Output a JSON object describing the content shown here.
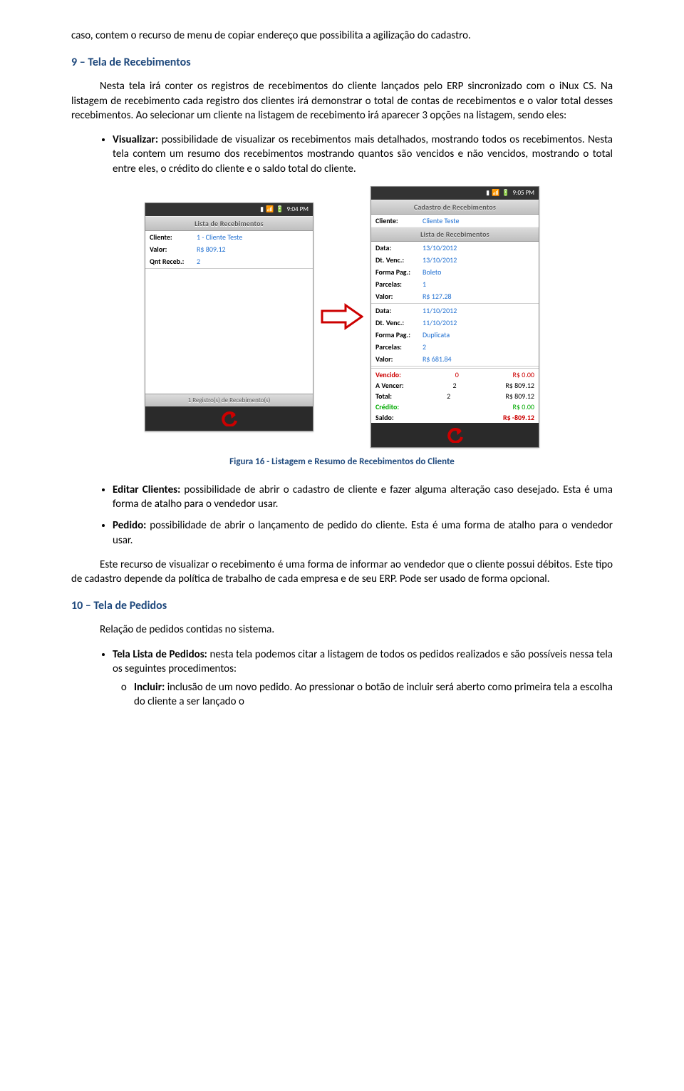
{
  "intro_para": "caso, contem o recurso de menu de copiar endereço que possibilita a agilização do cadastro.",
  "section9": {
    "heading": "9 – Tela de Recebimentos",
    "para": "Nesta tela irá conter os registros de recebimentos do cliente lançados pelo ERP sincronizado com o iNux CS. Na listagem de recebimento cada registro dos clientes irá demonstrar o total de contas de recebimentos e o valor total desses recebimentos. Ao selecionar um cliente na listagem de recebimento irá aparecer 3 opções na listagem, sendo eles:",
    "bullets": {
      "visualizar_label": "Visualizar:",
      "visualizar_text": " possibilidade de visualizar os recebimentos mais detalhados, mostrando todos os recebimentos. Nesta tela contem um resumo dos recebimentos mostrando quantos são vencidos e não vencidos, mostrando o total entre eles, o crédito do cliente e o saldo total do cliente.",
      "editar_label": "Editar Clientes:",
      "editar_text": " possibilidade de abrir o cadastro de cliente e fazer alguma alteração caso desejado. Esta é uma forma de atalho para o vendedor usar.",
      "pedido_label": "Pedido:",
      "pedido_text": " possibilidade de abrir o lançamento de pedido do cliente. Esta é uma forma de atalho para o vendedor usar."
    },
    "caption": "Figura 16 - Listagem e Resumo de Recebimentos do Cliente",
    "closing": "Este recurso de visualizar o recebimento é uma forma de informar ao vendedor que o cliente possui débitos. Este tipo de cadastro depende da política de trabalho de cada empresa e de seu ERP. Pode ser usado de forma opcional."
  },
  "section10": {
    "heading": "10 – Tela de Pedidos",
    "para": "Relação de pedidos contidas no sistema.",
    "bullets": {
      "lista_label": "Tela Lista de Pedidos:",
      "lista_text": " nesta tela podemos citar a listagem de todos os pedidos realizados e são possíveis nessa tela os seguintes procedimentos:",
      "incluir_label": "Incluir:",
      "incluir_text": " inclusão de um novo pedido. Ao pressionar o botão de incluir será aberto como primeira tela a escolha do cliente a ser lançado o"
    }
  },
  "phone_left": {
    "time": "9:04 PM",
    "title": "Lista de Recebimentos",
    "rows": {
      "cliente_lbl": "Cliente:",
      "cliente_val": "1 - Cliente Teste",
      "valor_lbl": "Valor:",
      "valor_val": "R$ 809.12",
      "qnt_lbl": "Qnt Receb.:",
      "qnt_val": "2"
    },
    "footer": "1 Registro(s) de Recebimento(s)"
  },
  "phone_right": {
    "time": "9:05 PM",
    "title1": "Cadastro de Recebimentos",
    "cliente_lbl": "Cliente:",
    "cliente_val": "Cliente Teste",
    "title2": "Lista de Recebimentos",
    "entry1": {
      "data_lbl": "Data:",
      "data_val": "13/10/2012",
      "venc_lbl": "Dt. Venc.:",
      "venc_val": "13/10/2012",
      "forma_lbl": "Forma Pag.:",
      "forma_val": "Boleto",
      "parc_lbl": "Parcelas:",
      "parc_val": "1",
      "valor_lbl": "Valor:",
      "valor_val": "R$ 127.28"
    },
    "entry2": {
      "data_lbl": "Data:",
      "data_val": "11/10/2012",
      "venc_lbl": "Dt. Venc.:",
      "venc_val": "11/10/2012",
      "forma_lbl": "Forma Pag.:",
      "forma_val": "Duplicata",
      "parc_lbl": "Parcelas:",
      "parc_val": "2",
      "valor_lbl": "Valor:",
      "valor_val": "R$ 681.84"
    },
    "summary": {
      "vencido_lbl": "Vencido:",
      "vencido_qty": "0",
      "vencido_val": "R$ 0.00",
      "avencer_lbl": "A Vencer:",
      "avencer_qty": "2",
      "avencer_val": "R$ 809.12",
      "total_lbl": "Total:",
      "total_qty": "2",
      "total_val": "R$ 809.12",
      "credito_lbl": "Crédito:",
      "credito_val": "R$ 0.00",
      "saldo_lbl": "Saldo:",
      "saldo_val": "R$ -809.12"
    }
  }
}
